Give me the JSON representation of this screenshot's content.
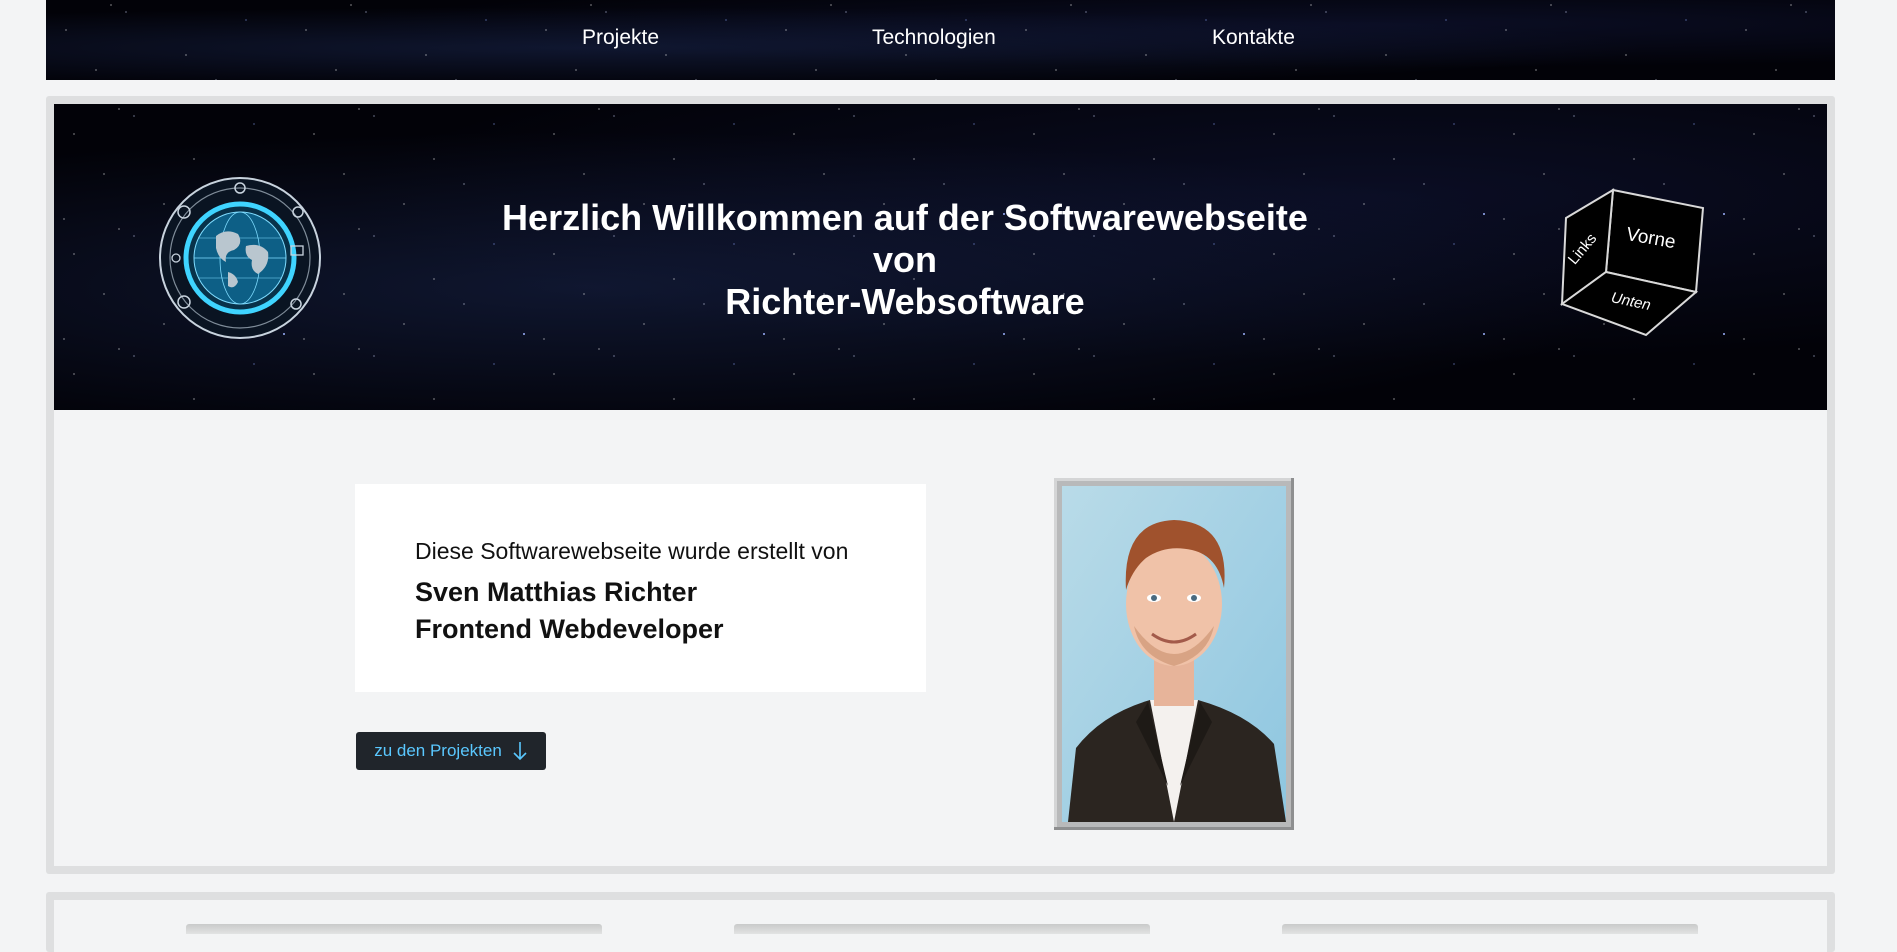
{
  "nav": {
    "items": [
      {
        "label": "Projekte"
      },
      {
        "label": "Technologien"
      },
      {
        "label": "Kontakte"
      }
    ]
  },
  "hero": {
    "title_lines": [
      "Herzlich Willkommen auf der Softwarewebseite",
      "von",
      "Richter-Websoftware"
    ],
    "cube_faces": {
      "left": "Links",
      "front": "Vorne",
      "bottom": "Unten"
    }
  },
  "intro_card": {
    "intro": "Diese Softwarewebseite wurde erstellt von",
    "name": "Sven Matthias Richter",
    "role": "Frontend Webdeveloper"
  },
  "cta": {
    "label": "zu den Projekten",
    "icon": "arrow-down-icon"
  },
  "colors": {
    "background": "#f3f4f5",
    "panel_border": "#dedfe0",
    "button_bg": "#20252b",
    "button_text": "#5ac8ff",
    "globe_accent": "#3fd4ff"
  }
}
